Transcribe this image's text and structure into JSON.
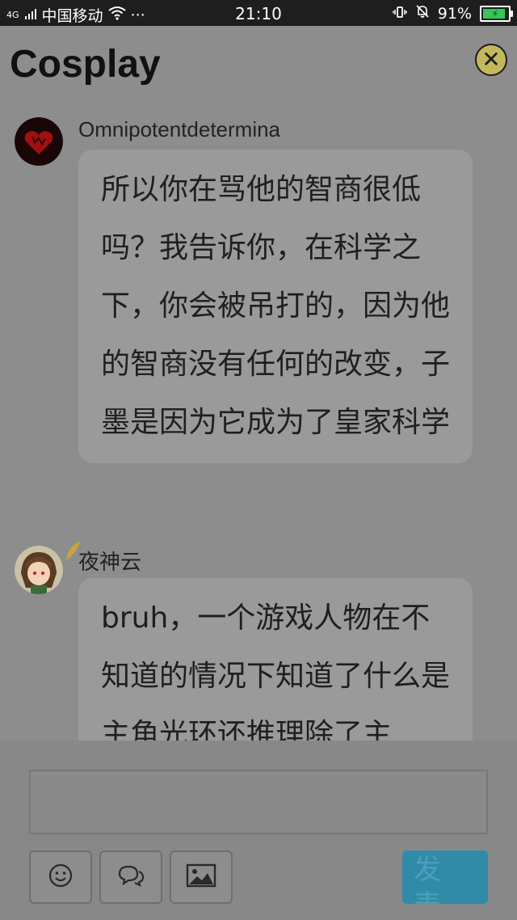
{
  "status_bar": {
    "network": "4G",
    "carrier": "中国移动",
    "dots": "···",
    "time": "21:10",
    "battery_percent": "91%",
    "battery_level": 0.91
  },
  "page": {
    "title": "Cosplay"
  },
  "messages": [
    {
      "username": "Omnipotentdetermina",
      "text": "所以你在骂他的智商很低吗？我告诉你，在科学之下，你会被吊打的，因为他的智商没有任何的改变，子墨是因为它成为了皇家科学"
    },
    {
      "username": "夜神云",
      "text": "bruh，一个游戏人物在不知道的情况下知道了什么是主角光环还推理除了主"
    }
  ],
  "input": {
    "placeholder": "",
    "value": ""
  },
  "toolbar": {
    "icons": [
      "emoji-icon",
      "comment-icon",
      "image-icon"
    ],
    "send_label": "发表"
  },
  "colors": {
    "send_button": "#2f8ba8",
    "close_button": "#c4b85d"
  }
}
